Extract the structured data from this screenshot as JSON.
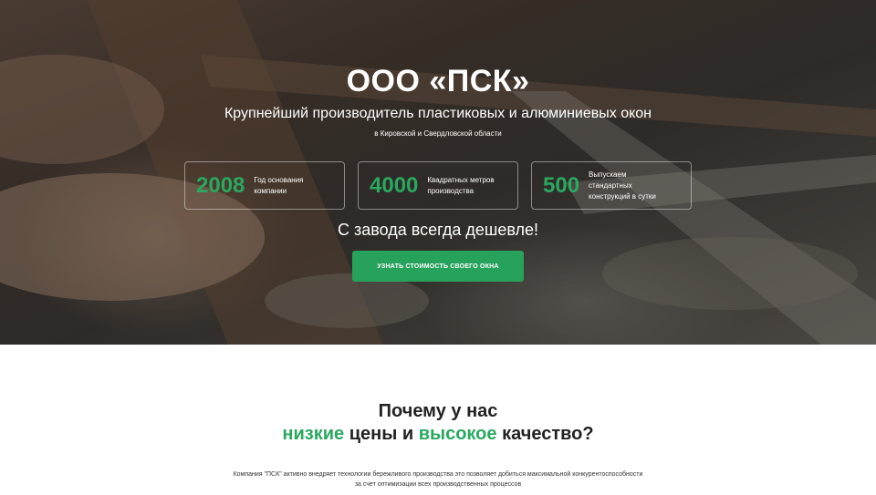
{
  "hero": {
    "title": "ООО «ПСК»",
    "subtitle": "Крупнейший производитель пластиковых и алюминиевых окон",
    "region": "в Кировской и Свердловской области",
    "stats": [
      {
        "number": "2008",
        "desc": "Год основания компании"
      },
      {
        "number": "4000",
        "desc": "Квадратных метров производства"
      },
      {
        "number": "500",
        "desc": "Выпускаем стандартных конструкций в сутки"
      }
    ],
    "slogan": "С завода всегда дешевле!",
    "cta_label": "УЗНАТЬ СТОИМОСТЬ СВОЕГО ОКНА"
  },
  "why": {
    "line1": "Почему у нас",
    "low": "низкие",
    "mid": " цены и ",
    "high": "высокое",
    "end": " качество?",
    "description": "Компания \"ПСК\" активно внедряет технологии бережливого производства это позволяет добиться максимальной конкурентоспособности за счет оптимизации всех производственных процессов"
  },
  "colors": {
    "accent": "#27a25c",
    "accent_text": "#2aa860"
  }
}
